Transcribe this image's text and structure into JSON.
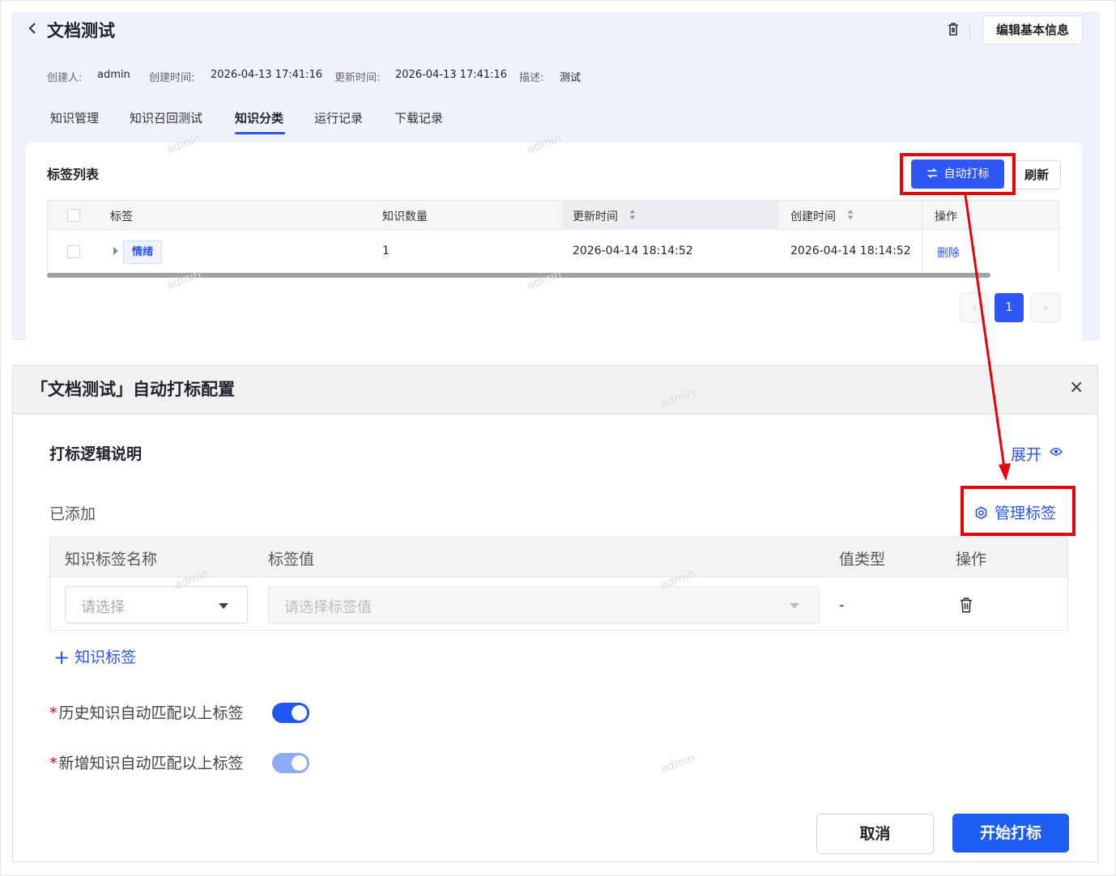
{
  "header": {
    "back_icon": "chevron-left-icon",
    "title": "文档测试",
    "delete_icon": "trash-icon",
    "edit_button": "编辑基本信息"
  },
  "meta": {
    "creator_label": "创建人:",
    "creator_value": "admin",
    "created_label": "创建时间:",
    "created_value": "2026-04-13 17:41:16",
    "updated_label": "更新时间:",
    "updated_value": "2026-04-13 17:41:16",
    "desc_label": "描述:",
    "desc_value": "测试"
  },
  "tabs": [
    {
      "label": "知识管理",
      "active": false
    },
    {
      "label": "知识召回测试",
      "active": false
    },
    {
      "label": "知识分类",
      "active": true
    },
    {
      "label": "运行记录",
      "active": false
    },
    {
      "label": "下载记录",
      "active": false
    }
  ],
  "tag_list": {
    "title": "标签列表",
    "auto_tag_button": "自动打标",
    "refresh_button": "刷新",
    "columns": [
      "标签",
      "知识数量",
      "更新时间",
      "创建时间",
      "操作"
    ],
    "rows": [
      {
        "tag": "情绪",
        "count": "1",
        "updated": "2026-04-14 18:14:52",
        "created": "2026-04-14 18:14:52",
        "action": "删除"
      }
    ],
    "pagination": {
      "current": "1",
      "prev": "‹",
      "next": "›"
    }
  },
  "modal": {
    "title": "「文档测试」自动打标配置",
    "close": "×",
    "logic_title": "打标逻辑说明",
    "expand_link": "展开",
    "added_label": "已添加",
    "manage_tags": "管理标签",
    "columns": [
      "知识标签名称",
      "标签值",
      "值类型",
      "操作"
    ],
    "row": {
      "name_placeholder": "请选择",
      "value_placeholder": "请选择标签值",
      "value_type": "-"
    },
    "add_tag": "知识标签",
    "add_icon": "+",
    "switch_history_label": "历史知识自动匹配以上标签",
    "switch_history_on": true,
    "switch_new_label": "新增知识自动匹配以上标签",
    "switch_new_on": true,
    "required_mark": "*",
    "cancel_button": "取消",
    "start_button": "开始打标"
  },
  "colors": {
    "primary": "#2e57f5",
    "annotation_red": "#e8000a",
    "switch_disabled": "#8eaaf5"
  }
}
